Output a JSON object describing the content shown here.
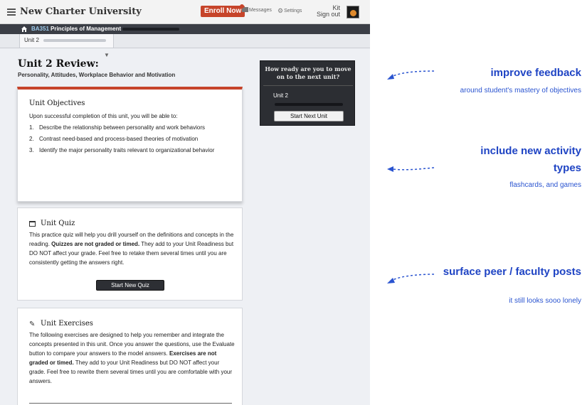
{
  "header": {
    "brand": "New Charter University",
    "enroll_label": "Enroll Now",
    "messages_label": "Messages",
    "settings_label": "Settings",
    "user_name": "Kit",
    "signout_label": "Sign out"
  },
  "course": {
    "code": "BA351",
    "name": "Principles of Management"
  },
  "unit_tab": {
    "label": "Unit 2"
  },
  "page": {
    "title": "Unit 2 Review:",
    "subtitle": "Personality, Attitudes, Workplace Behavior and Motivation"
  },
  "objectives": {
    "title": "Unit Objectives",
    "intro": "Upon successful completion of this unit, you will be able to:",
    "items": [
      {
        "num": "1.",
        "text": "Describe the relationship between personality and work behaviors"
      },
      {
        "num": "2.",
        "text": "Contrast need-based and process-based theories of motivation"
      },
      {
        "num": "3.",
        "text": "Identify the major personality traits relevant to organizational behavior"
      }
    ]
  },
  "quiz": {
    "title": "Unit Quiz",
    "text_before": "This practice quiz will help you drill yourself on the definitions and concepts in the reading. ",
    "text_bold": "Quizzes are not graded or timed.",
    "text_after": " They add to your Unit Readiness but DO NOT affect your grade. Feel free to retake them several times until you are consistently getting the answers right.",
    "button": "Start New Quiz"
  },
  "exercises": {
    "title": "Unit Exercises",
    "text_before": "The following exercises are designed to help you remember and integrate the concepts presented in this unit. Once you answer the questions, use the Evaluate button to compare your answers to the model answers. ",
    "text_bold": "Exercises are not graded or timed.",
    "text_after": " They add to your Unit Readiness but DO NOT affect your grade. Feel free to rewrite them several times until you are comfortable with your answers."
  },
  "readiness": {
    "question": "How ready are you to move on to the next unit?",
    "unit_label": "Unit 2",
    "button": "Start Next Unit"
  },
  "annotations": [
    {
      "title": "improve feedback",
      "sub": "around student's mastery of objectives"
    },
    {
      "title": "include new activity types",
      "sub": "flashcards, and games"
    },
    {
      "title": "surface peer / faculty posts",
      "sub": "it still looks sooo lonely"
    }
  ],
  "colors": {
    "accent": "#c6442a",
    "annotation": "#1f44c4",
    "dark_bar": "#3b3e46"
  }
}
